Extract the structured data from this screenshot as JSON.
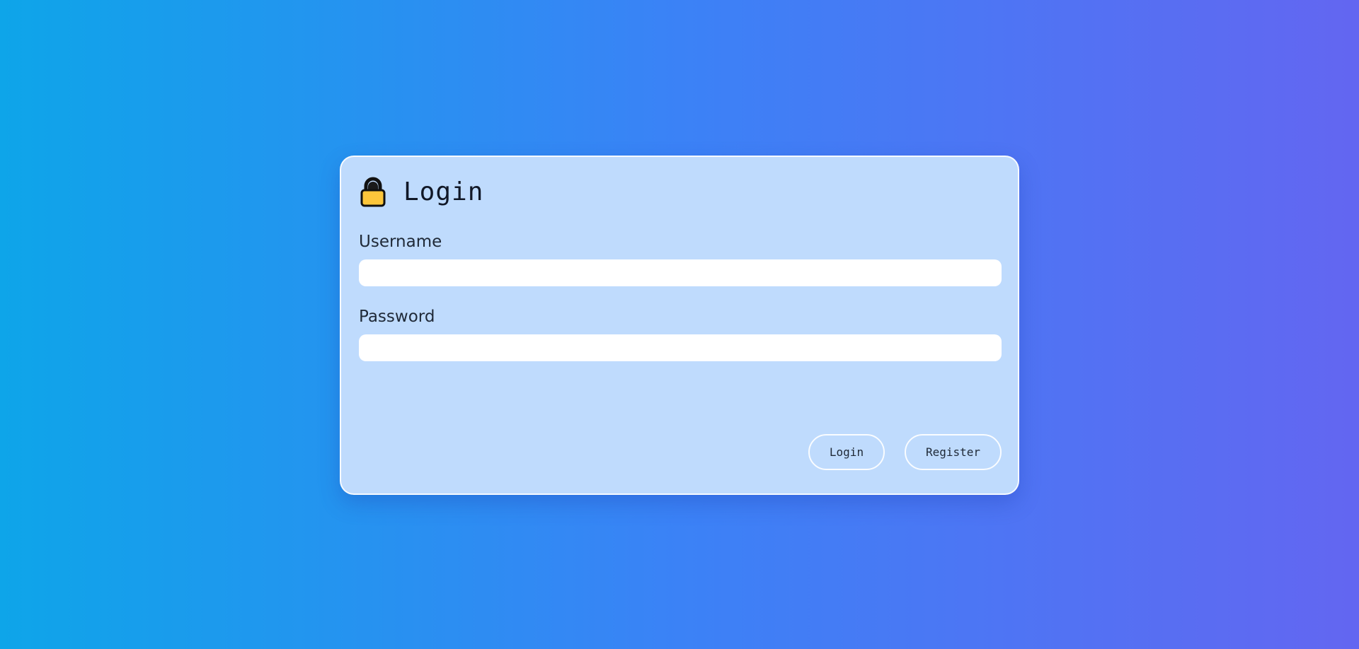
{
  "login_card": {
    "title": "Login",
    "title_icon": "lock-icon",
    "username": {
      "label": "Username",
      "value": "",
      "placeholder": ""
    },
    "password": {
      "label": "Password",
      "value": "",
      "placeholder": ""
    },
    "buttons": {
      "login_label": "Login",
      "register_label": "Register"
    }
  },
  "colors": {
    "background_start": "#0ea5e9",
    "background_end": "#6366f1",
    "card_background": "#bfdbfd",
    "lock_body": "#fcc63b"
  }
}
